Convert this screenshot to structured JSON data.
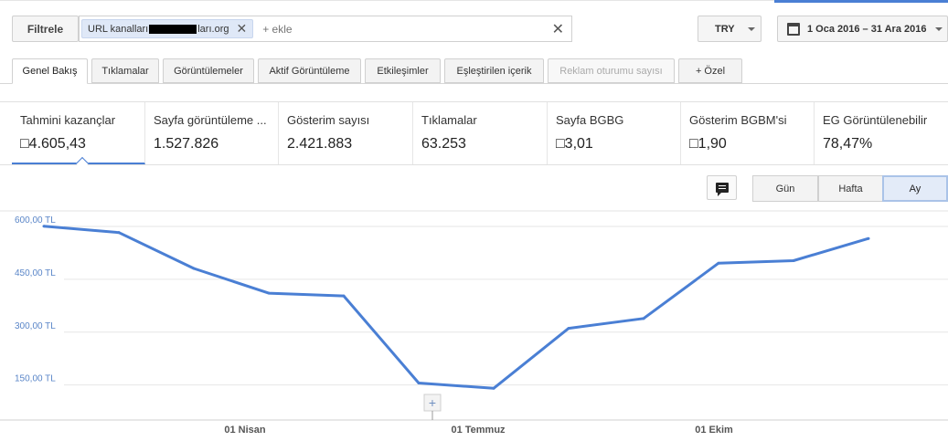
{
  "filter": {
    "button_label": "Filtrele",
    "chip_label_start": "URL kanalları",
    "chip_label_end": "ları.org",
    "add_placeholder": "+ ekle"
  },
  "currency": {
    "label": "TRY"
  },
  "date_range": {
    "label": "1 Oca 2016 – 31 Ara 2016"
  },
  "tabs": [
    {
      "label": "Genel Bakış"
    },
    {
      "label": "Tıklamalar"
    },
    {
      "label": "Görüntülemeler"
    },
    {
      "label": "Aktif Görüntüleme"
    },
    {
      "label": "Etkileşimler"
    },
    {
      "label": "Eşleştirilen içerik"
    },
    {
      "label": "Reklam oturumu sayısı"
    },
    {
      "label": "+ Özel"
    }
  ],
  "metrics": [
    {
      "label": "Tahmini kazançlar",
      "value": "□4.605,43"
    },
    {
      "label": "Sayfa görüntüleme ...",
      "value": "1.527.826"
    },
    {
      "label": "Gösterim sayısı",
      "value": "2.421.883"
    },
    {
      "label": "Tıklamalar",
      "value": "63.253"
    },
    {
      "label": "Sayfa BGBG",
      "value": "□3,01"
    },
    {
      "label": "Gösterim BGBM'si",
      "value": "□1,90"
    },
    {
      "label": "EG Görüntülenebilir",
      "value": "78,47%"
    }
  ],
  "period": {
    "day": "Gün",
    "week": "Hafta",
    "month": "Ay",
    "selected": "Ay"
  },
  "chart_data": {
    "type": "line",
    "x": [
      "2016-01",
      "2016-02",
      "2016-03",
      "2016-04",
      "2016-05",
      "2016-06",
      "2016-07",
      "2016-08",
      "2016-09",
      "2016-10",
      "2016-11",
      "2016-12"
    ],
    "series": [
      {
        "values": [
          580,
          562,
          460,
          390,
          382,
          135,
          120,
          290,
          318,
          475,
          482,
          545
        ]
      }
    ],
    "yticks": [
      "600,00 TL",
      "450,00 TL",
      "300,00 TL",
      "150,00 TL"
    ],
    "ytick_values": [
      600,
      450,
      300,
      150
    ],
    "xticks": [
      "01 Nisan",
      "01 Temmuz",
      "01 Ekim"
    ],
    "ylim": [
      0,
      620
    ],
    "grid": true,
    "color": "#4a7fd4"
  }
}
